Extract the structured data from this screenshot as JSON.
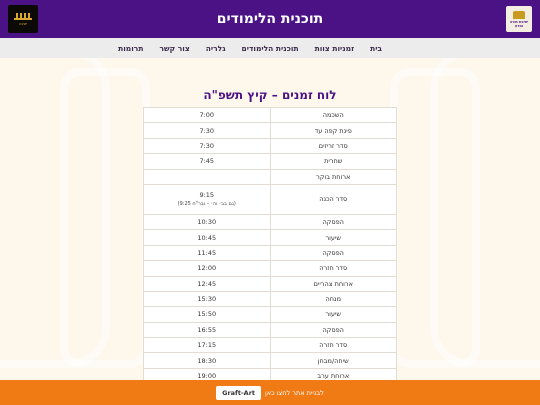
{
  "header": {
    "title": "תוכנית הלימודים",
    "logo_right_text": "ישיבת תורה ומדע",
    "logo_left_text": "ישיבה"
  },
  "nav": {
    "items": [
      "בית",
      "זמניות צוות",
      "תוכנית הלימודים",
      "גלריה",
      "צור קשר",
      "תרומות"
    ]
  },
  "schedule": {
    "title": "לוח זמנים – קיץ תשפ\"ה",
    "rows": [
      {
        "activity": "השכמה",
        "time": "7:00"
      },
      {
        "activity": "פינת קפה עד",
        "time": "7:30"
      },
      {
        "activity": "סדר זריזים",
        "time": "7:30"
      },
      {
        "activity": "שחרית",
        "time": "7:45"
      },
      {
        "activity": "ארוחת בוקר",
        "time": ""
      },
      {
        "activity": "סדר הכנה",
        "time": "9:15",
        "note": "(גם בב׳ וה׳ – ובר\"ח 9:25)"
      },
      {
        "activity": "הפסקה",
        "time": "10:30"
      },
      {
        "activity": "שיעור",
        "time": "10:45"
      },
      {
        "activity": "הפסקה",
        "time": "11:45"
      },
      {
        "activity": "סדר חזרה",
        "time": "12:00"
      },
      {
        "activity": "ארוחת צהריים",
        "time": "12:45"
      },
      {
        "activity": "מנחה",
        "time": "15:30"
      },
      {
        "activity": "שיעור",
        "time": "15:50"
      },
      {
        "activity": "הפסקה",
        "time": "16:55"
      },
      {
        "activity": "סדר חזרה",
        "time": "17:15"
      },
      {
        "activity": "שיחה/מבחן",
        "time": "18:30"
      },
      {
        "activity": "ארוחת ערב",
        "time": "19:00"
      }
    ]
  },
  "footer": {
    "text": "לבניית אתר לחצו כאן",
    "button": "Graft-Art"
  },
  "colors": {
    "header_bg": "#4b1286",
    "footer_bg": "#f07a13",
    "title": "#4b1286"
  }
}
